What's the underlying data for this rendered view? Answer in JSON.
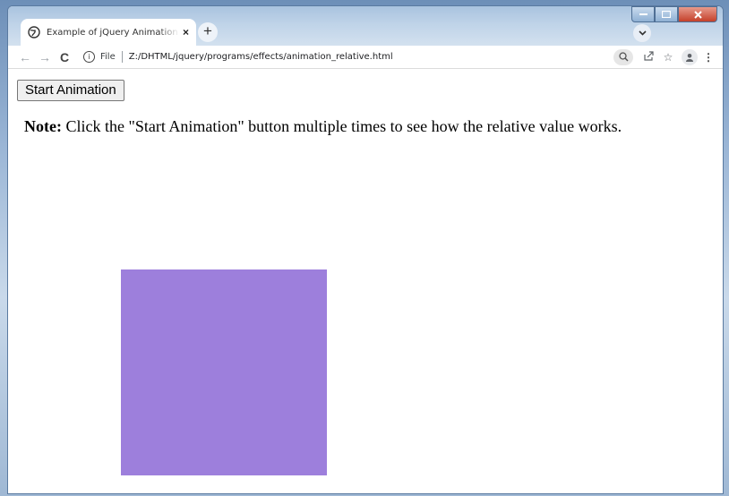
{
  "browser": {
    "tab_title": "Example of jQuery Animation with Relative Values",
    "tab_close": "×",
    "new_tab": "+",
    "url_scheme": "File",
    "url": "Z:/DHTML/jquery/programs/effects/animation_relative.html"
  },
  "page": {
    "button_label": "Start Animation",
    "note_label": "Note:",
    "note_text": " Click the \"Start Animation\" button multiple times to see how the relative value works."
  },
  "colors": {
    "box": "#9d7fdc"
  },
  "icons": [
    "globe-icon",
    "close-icon",
    "plus-icon",
    "chevron-down-icon",
    "back-arrow-icon",
    "forward-arrow-icon",
    "reload-icon",
    "info-icon",
    "zoom-icon",
    "share-icon",
    "star-icon",
    "profile-icon",
    "menu-icon",
    "minimize-icon",
    "maximize-icon",
    "window-close-icon"
  ]
}
